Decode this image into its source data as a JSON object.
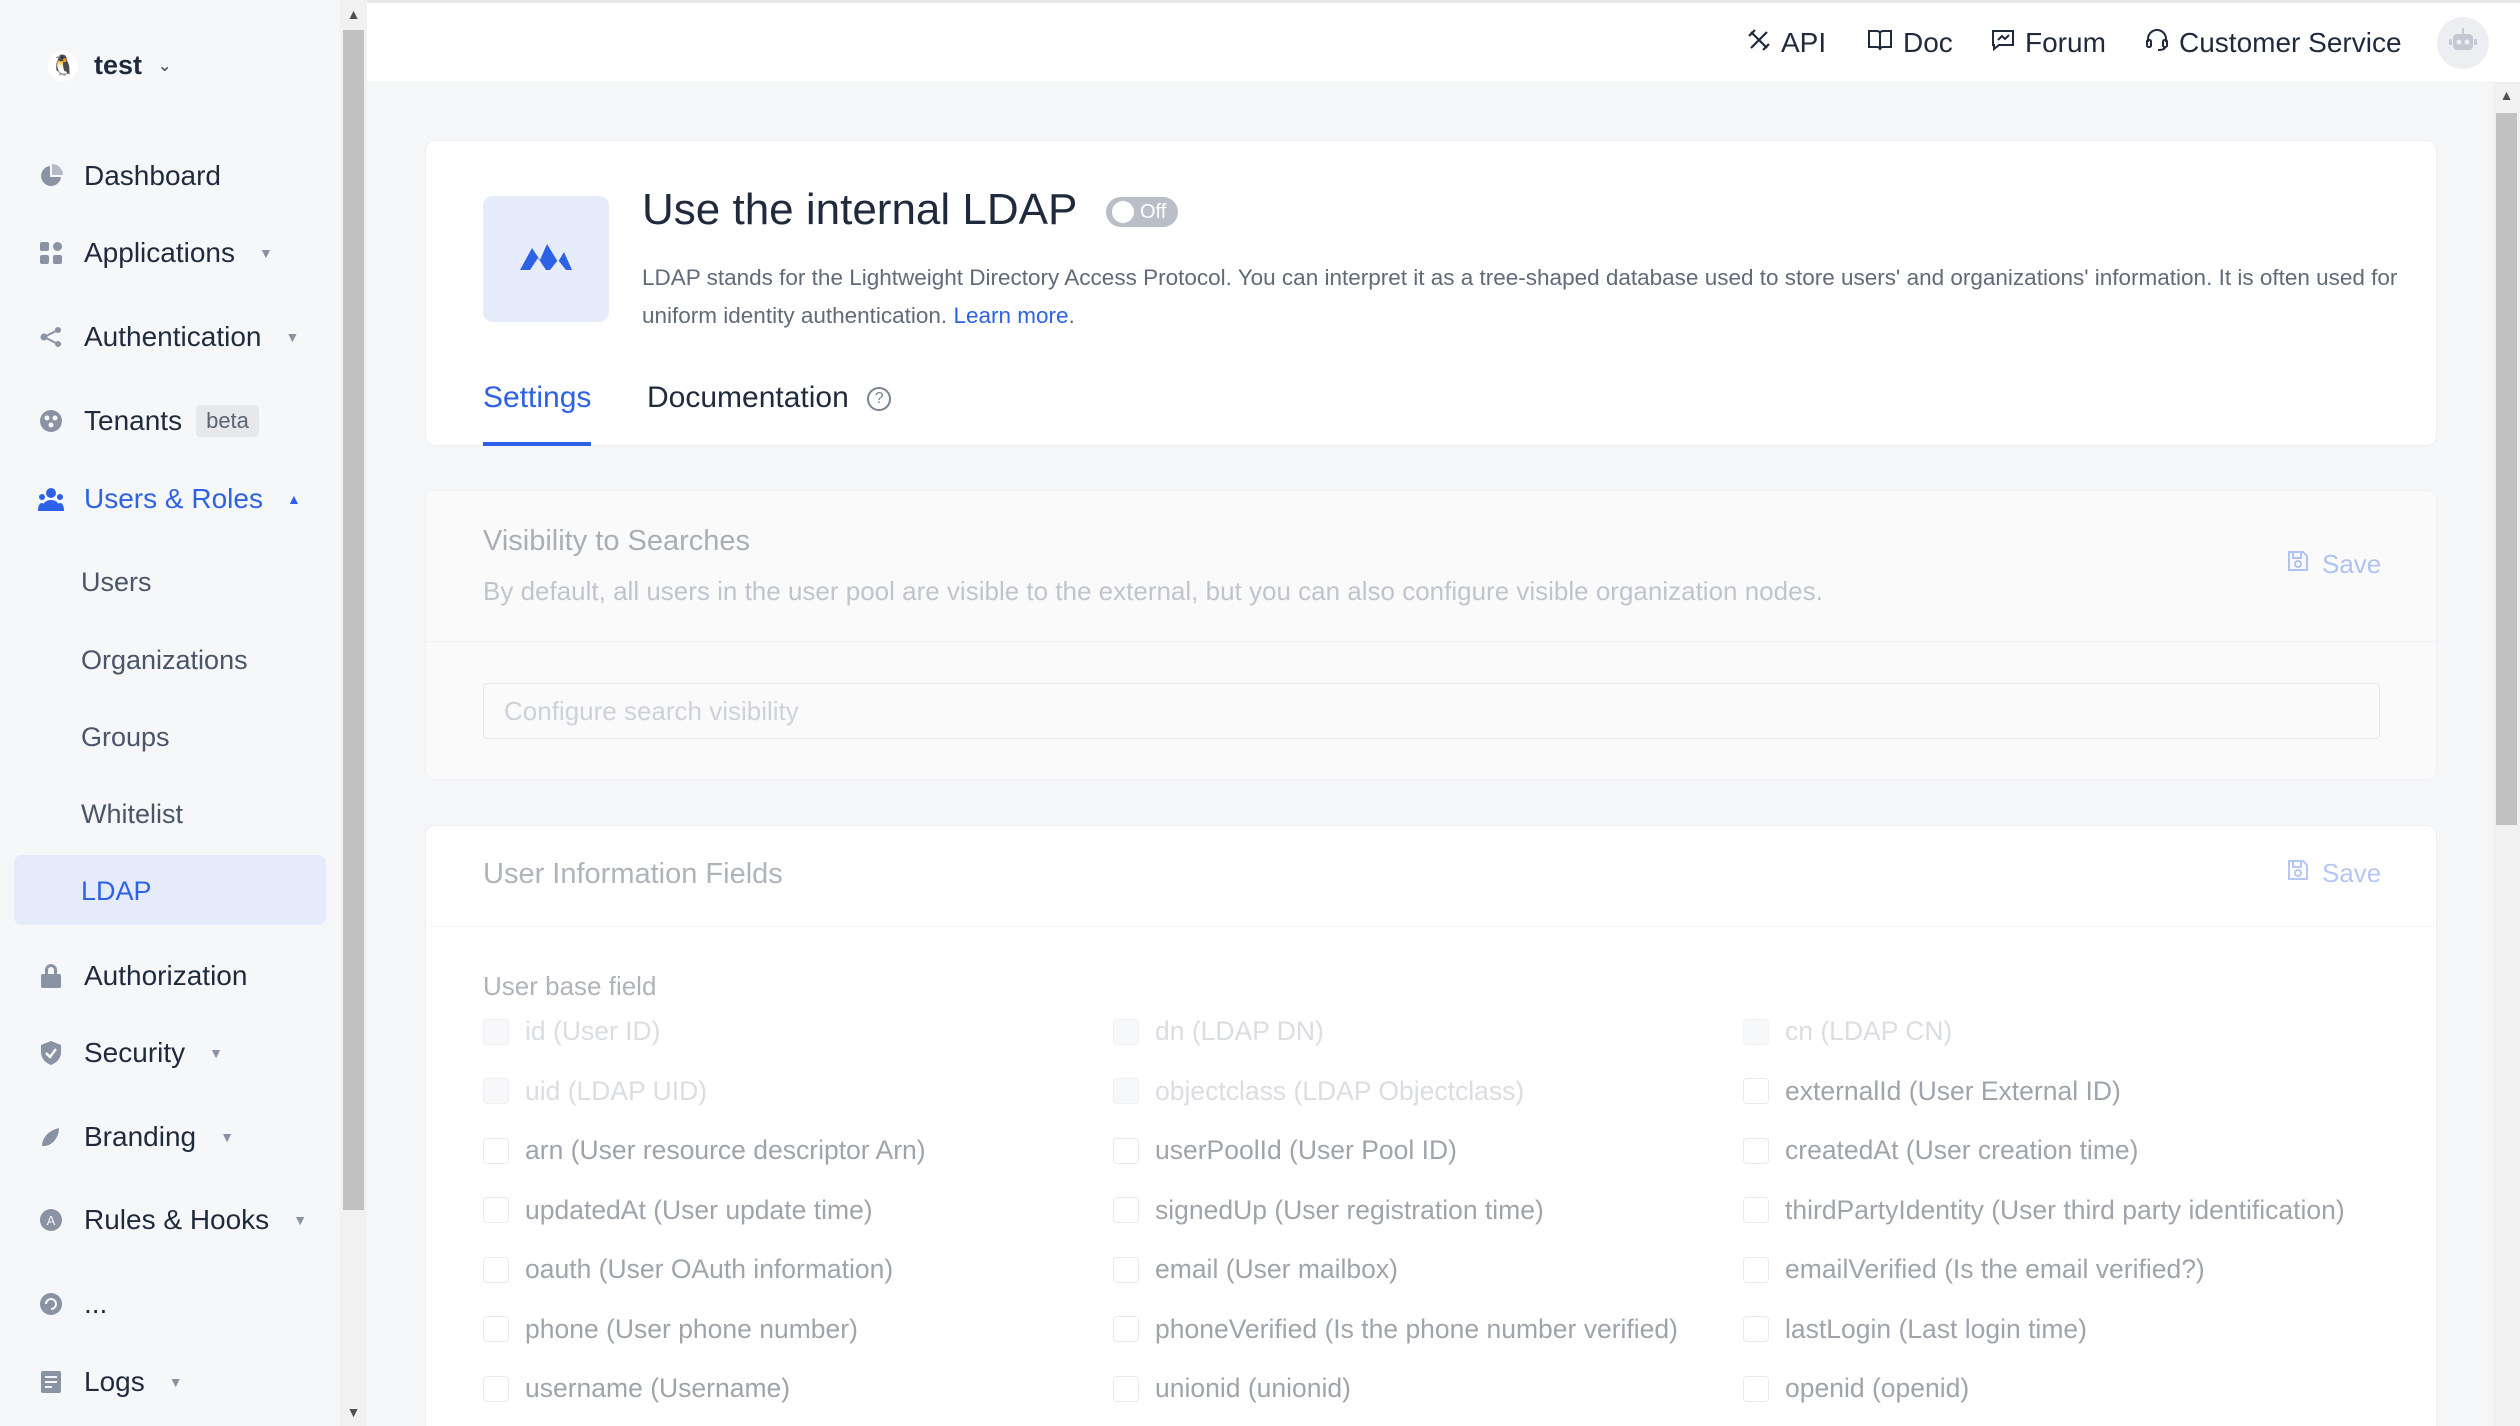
{
  "org": {
    "name": "test"
  },
  "sidebar": {
    "items": [
      {
        "label": "Dashboard"
      },
      {
        "label": "Applications"
      },
      {
        "label": "Authentication"
      },
      {
        "label": "Tenants",
        "badge": "beta"
      },
      {
        "label": "Users & Roles"
      },
      {
        "label": "Authorization"
      },
      {
        "label": "Security"
      },
      {
        "label": "Branding"
      },
      {
        "label": "Rules & Hooks"
      },
      {
        "label": "..."
      },
      {
        "label": "Logs"
      }
    ],
    "sub_items": [
      {
        "label": "Users"
      },
      {
        "label": "Organizations"
      },
      {
        "label": "Groups"
      },
      {
        "label": "Whitelist"
      },
      {
        "label": "LDAP"
      }
    ]
  },
  "topbar": {
    "api": "API",
    "doc": "Doc",
    "forum": "Forum",
    "customer_service": "Customer Service"
  },
  "header": {
    "title": "Use the internal LDAP",
    "toggle": "Off",
    "description": "LDAP stands for the Lightweight Directory Access Protocol. You can interpret it as a tree-shaped database used to store users' and organizations' information. It is often used for uniform identity authentication.",
    "learn_more": "Learn more",
    "tabs": [
      "Settings",
      "Documentation"
    ]
  },
  "visibility": {
    "title": "Visibility to Searches",
    "description": "By default, all users in the user pool are visible to the external, but you can also configure visible organization nodes.",
    "save": "Save",
    "placeholder": "Configure search visibility"
  },
  "fields": {
    "title": "User Information Fields",
    "save": "Save",
    "subhead": "User base field",
    "items": [
      {
        "label": "id (User ID)",
        "disabled": true
      },
      {
        "label": "dn (LDAP DN)",
        "disabled": true
      },
      {
        "label": "cn (LDAP CN)",
        "disabled": true
      },
      {
        "label": "uid (LDAP UID)",
        "disabled": true
      },
      {
        "label": "objectclass (LDAP Objectclass)",
        "disabled": true
      },
      {
        "label": "externalId (User External ID)",
        "disabled": false
      },
      {
        "label": "arn (User resource descriptor Arn)",
        "disabled": false
      },
      {
        "label": "userPoolId (User Pool ID)",
        "disabled": false
      },
      {
        "label": "createdAt (User creation time)",
        "disabled": false
      },
      {
        "label": "updatedAt (User update time)",
        "disabled": false
      },
      {
        "label": "signedUp (User registration time)",
        "disabled": false
      },
      {
        "label": "thirdPartyIdentity (User third party identification)",
        "disabled": false
      },
      {
        "label": "oauth (User OAuth information)",
        "disabled": false
      },
      {
        "label": "email (User mailbox)",
        "disabled": false
      },
      {
        "label": "emailVerified (Is the email verified?)",
        "disabled": false
      },
      {
        "label": "phone (User phone number)",
        "disabled": false
      },
      {
        "label": "phoneVerified (Is the phone number verified)",
        "disabled": false
      },
      {
        "label": "lastLogin (Last login time)",
        "disabled": false
      },
      {
        "label": "username (Username)",
        "disabled": false
      },
      {
        "label": "unionid (unionid)",
        "disabled": false
      },
      {
        "label": "openid (openid)",
        "disabled": false
      }
    ]
  }
}
